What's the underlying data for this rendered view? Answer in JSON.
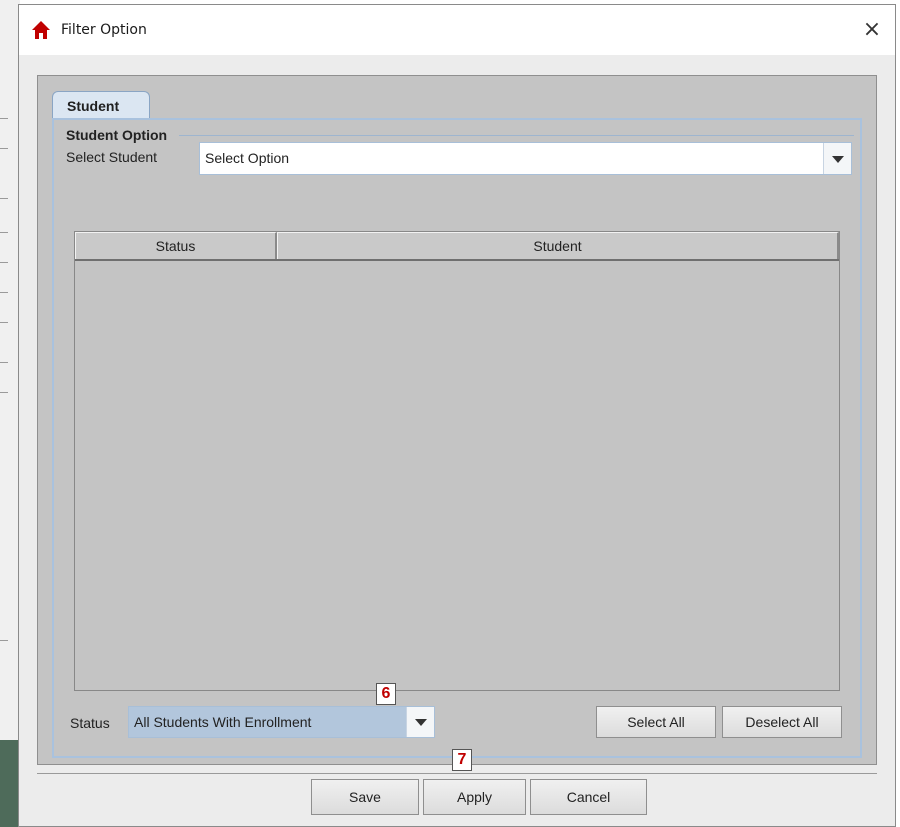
{
  "window": {
    "title": "Filter Option",
    "close_symbol": "×",
    "app_icon": "house-icon",
    "app_icon_color": "#c00000"
  },
  "tabs": [
    {
      "label": "Student",
      "selected": true
    }
  ],
  "student_option": {
    "section_title": "Student Option",
    "select_label": "Select Student",
    "select_value": "Select Option"
  },
  "table": {
    "columns": [
      "Status",
      "Student"
    ],
    "rows": []
  },
  "footer": {
    "status_label": "Status",
    "status_value": "All Students With Enrollment",
    "select_all": "Select All",
    "deselect_all": "Deselect All"
  },
  "dialog_buttons": {
    "save": "Save",
    "apply": "Apply",
    "cancel": "Cancel"
  },
  "annotations": [
    {
      "label": "6",
      "color": "#c00000"
    },
    {
      "label": "7",
      "color": "#c00000"
    }
  ]
}
